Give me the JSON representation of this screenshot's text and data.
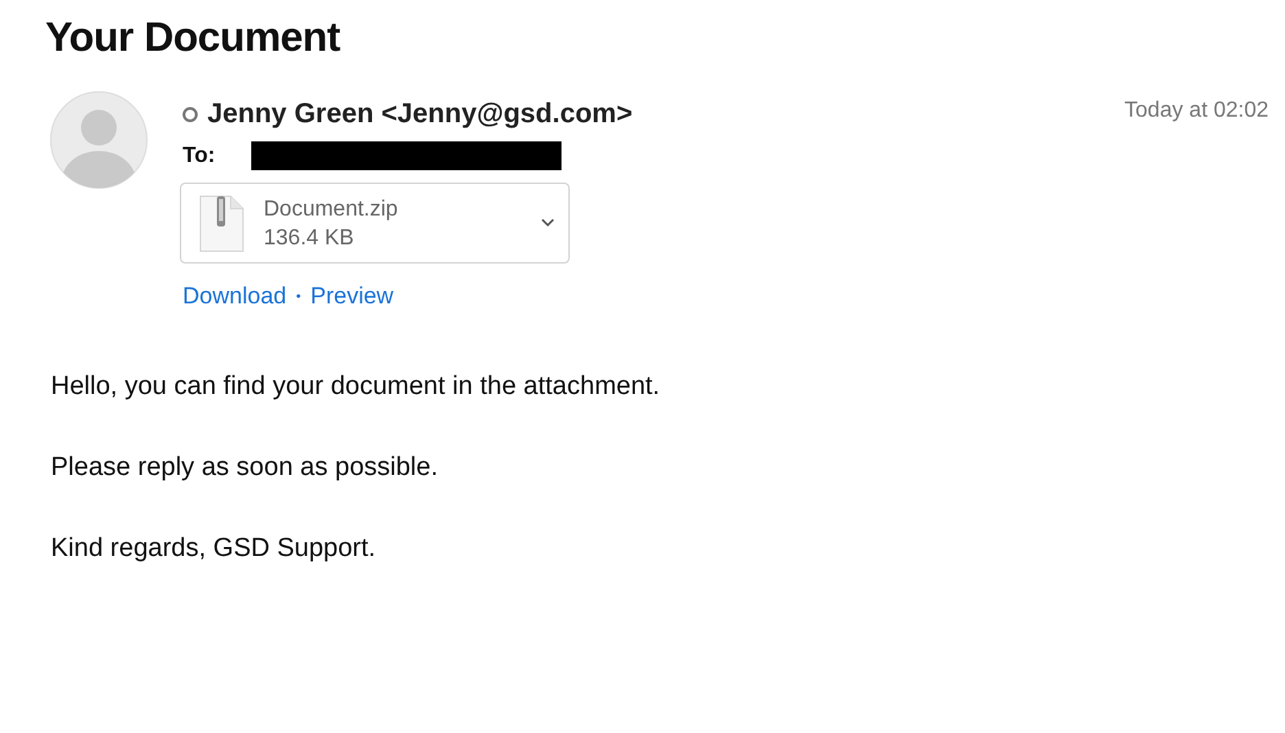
{
  "subject": "Your Document",
  "sender": {
    "name": "Jenny Green <Jenny@gsd.com>",
    "online": false
  },
  "time": "Today at 02:02",
  "recipient": {
    "label": "To:",
    "redacted": true
  },
  "attachment": {
    "filename": "Document.zip",
    "size": "136.4 KB",
    "expanded": false
  },
  "actions": [
    {
      "kind": "link",
      "text": "Download"
    },
    {
      "kind": "separator",
      "text": "•"
    },
    {
      "kind": "link",
      "text": "Preview"
    }
  ],
  "body": [
    "Hello, you can find your document in the attachment.",
    "Please reply as soon as possible.",
    "Kind regards, GSD Support."
  ]
}
